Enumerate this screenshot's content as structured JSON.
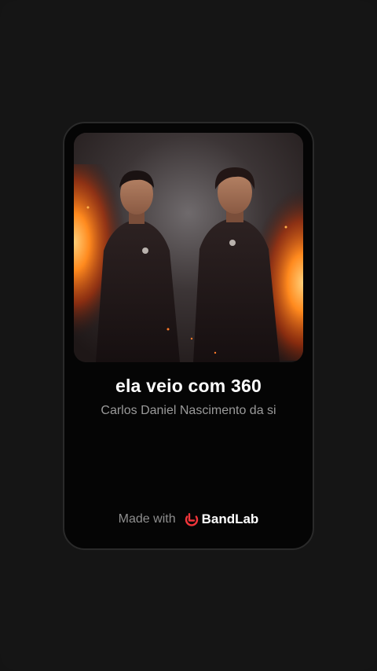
{
  "track": {
    "title": "ela veio com 360",
    "artist": "Carlos Daniel Nascimento da si"
  },
  "footer": {
    "made_with": "Made with",
    "brand_name": "BandLab"
  },
  "icons": {
    "brand_logo": "bandlab-logo-icon"
  },
  "colors": {
    "background": "#151515",
    "card": "#050505",
    "brand_accent": "#f0353a",
    "title_text": "#ffffff",
    "secondary_text": "#9a9a9a"
  }
}
